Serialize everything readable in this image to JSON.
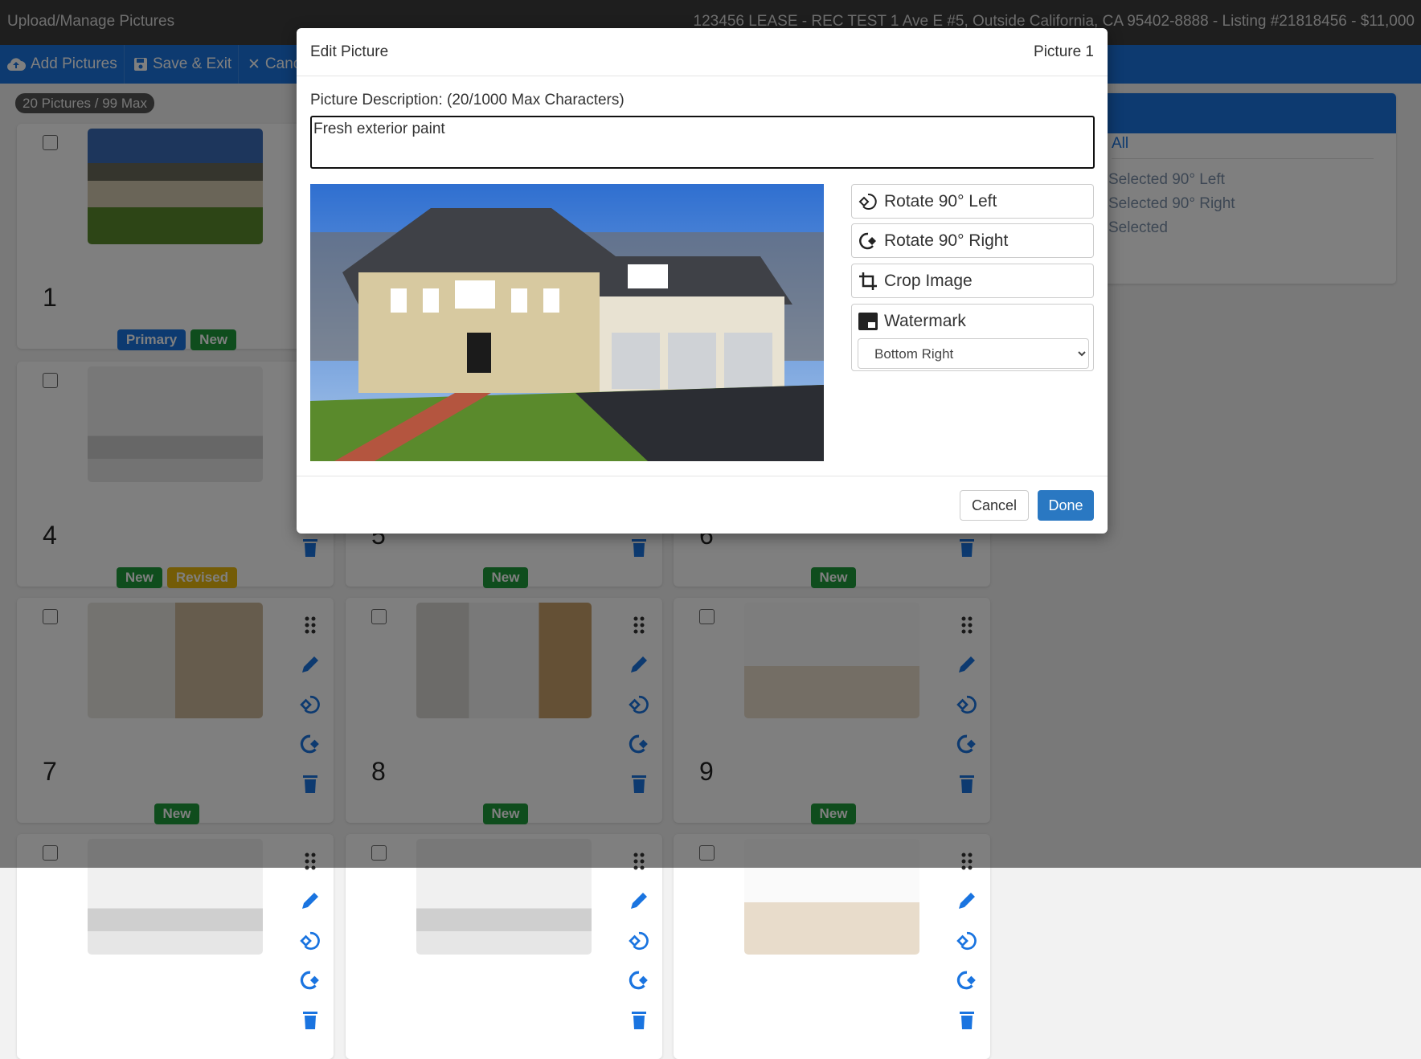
{
  "header": {
    "title": "Upload/Manage Pictures",
    "listing": "123456 LEASE - REC TEST 1 Ave E #5, Outside California, CA 95402-8888 - Listing #21818456 - $11,000"
  },
  "toolbar": {
    "add": "Add Pictures",
    "save": "Save & Exit",
    "cancel": "Cancel"
  },
  "count_badge": "20 Pictures / 99 Max",
  "colors": {
    "primary": "#1a74e0",
    "new": "#1e9a3a",
    "revised": "#e8b90e",
    "done": "#2a78c2"
  },
  "cards": [
    {
      "number": "1",
      "badges": [
        "Primary",
        "New"
      ],
      "thumb": "exterior"
    },
    {
      "number": "",
      "badges": [],
      "thumb": "living"
    },
    {
      "number": "",
      "badges": [],
      "thumb": "living"
    },
    {
      "number": "4",
      "badges": [
        "New",
        "Revised"
      ],
      "thumb": "living"
    },
    {
      "number": "5",
      "badges": [
        "New"
      ],
      "thumb": "living"
    },
    {
      "number": "6",
      "badges": [
        "New"
      ],
      "thumb": "living"
    },
    {
      "number": "7",
      "badges": [
        "New"
      ],
      "thumb": "room"
    },
    {
      "number": "8",
      "badges": [
        "New"
      ],
      "thumb": "laundry"
    },
    {
      "number": "9",
      "badges": [
        "New"
      ],
      "thumb": "bright"
    },
    {
      "number": "",
      "badges": [],
      "thumb": "living"
    },
    {
      "number": "",
      "badges": [],
      "thumb": "living"
    },
    {
      "number": "",
      "badges": [],
      "thumb": "bright"
    }
  ],
  "right_panel": {
    "items": [
      "All",
      "Selected 90° Left",
      "Selected 90° Right",
      "Selected"
    ]
  },
  "modal": {
    "title": "Edit Picture",
    "picture_label": "Picture 1",
    "description_label": "Picture Description: (20/1000 Max Characters)",
    "description_value": "Fresh exterior paint",
    "rotate_left": "Rotate 90° Left",
    "rotate_right": "Rotate 90° Right",
    "crop": "Crop Image",
    "watermark": "Watermark",
    "watermark_position": "Bottom Right",
    "cancel": "Cancel",
    "done": "Done"
  }
}
